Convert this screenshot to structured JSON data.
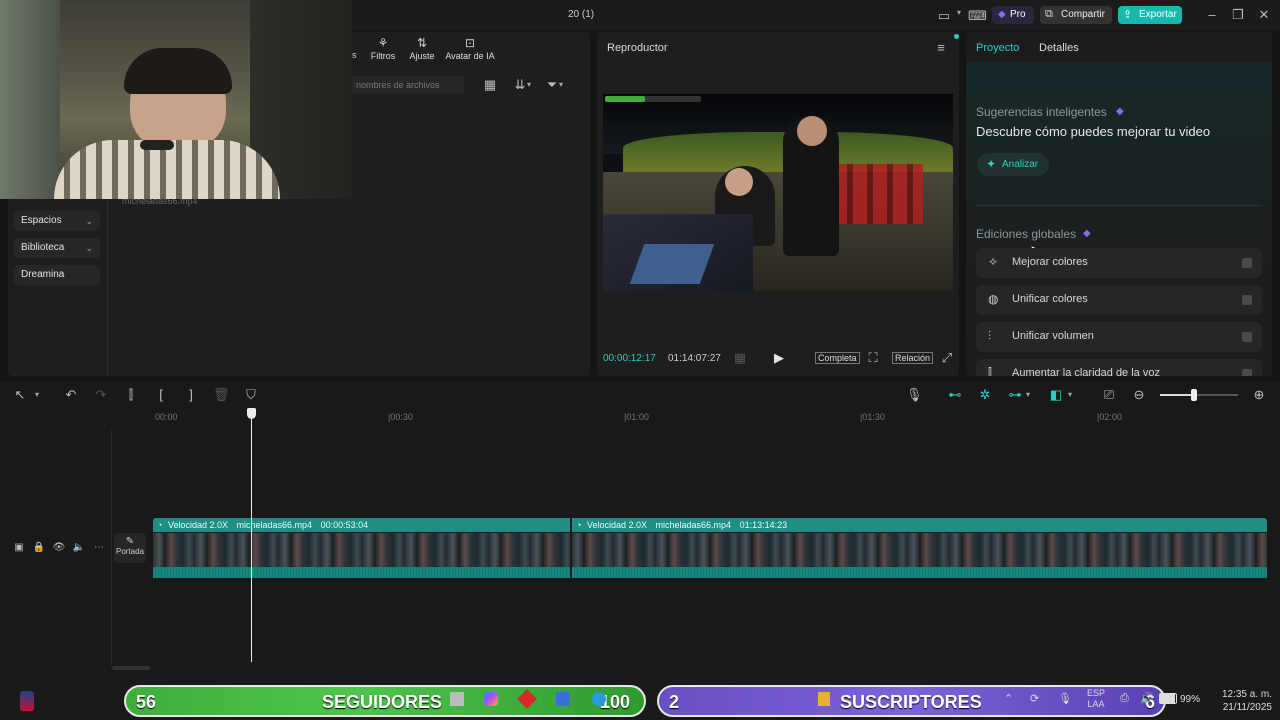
{
  "window": {
    "title": "20 (1)",
    "pro_label": "Pro",
    "share_label": "Compartir",
    "export_label": "Exportar"
  },
  "media_panel": {
    "tabs": [
      "Filtros",
      "Ajuste",
      "Avatar de IA"
    ],
    "search_placeholder": "nombres de archivos",
    "file_name": "micheladas66.mp4",
    "sidebar": [
      {
        "label": "Espacios",
        "has_chevron": true
      },
      {
        "label": "Biblioteca",
        "has_chevron": true
      },
      {
        "label": "Dreamina",
        "has_chevron": false
      }
    ]
  },
  "player": {
    "title": "Reproductor",
    "current_time": "00:00:12:17",
    "total_time": "01:14:07:27",
    "full_label": "Completa",
    "ratio_label": "Relación"
  },
  "right_panel": {
    "tabs": [
      "Proyecto",
      "Detalles"
    ],
    "active_tab": "Proyecto",
    "suggestions_title": "Sugerencias inteligentes",
    "suggestions_heading": "Descubre cómo puedes mejorar tu video",
    "analyze_label": "Analizar",
    "global_edits_title": "Ediciones globales",
    "global_edits": [
      {
        "label": "Mejorar colores",
        "icon": "magic-wand-icon"
      },
      {
        "label": "Unificar colores",
        "icon": "palette-icon"
      },
      {
        "label": "Unificar volumen",
        "icon": "sliders-icon"
      },
      {
        "label": "Aumentar la claridad de la voz",
        "icon": "voice-wave-icon"
      }
    ]
  },
  "timeline": {
    "ruler_labels": [
      "00:00",
      "|00:30",
      "|01:00",
      "|01:30",
      "|02:00"
    ],
    "cover_label": "Portada",
    "clips": [
      {
        "speed": "Velocidad 2.0X",
        "name": "micheladas66.mp4",
        "duration": "00:00:53:04"
      },
      {
        "speed": "Velocidad 2.0X",
        "name": "micheladas66.mp4",
        "duration": "01:13:14:23"
      }
    ]
  },
  "overlays": {
    "followers_count": "56",
    "followers_label": "SEGUIDORES",
    "followers_goal": "100",
    "subscribers_count": "2",
    "subscribers_label": "SUSCRIPTORES",
    "subscribers_goal": "6"
  },
  "taskbar": {
    "language": "ESP",
    "layout": "LAA",
    "battery": "99%",
    "time": "12:35 a. m.",
    "date": "21/11/2025"
  },
  "colors": {
    "accent": "#22d3c5",
    "clip": "#1f8f86",
    "pro_purple": "#8b6cf0"
  }
}
